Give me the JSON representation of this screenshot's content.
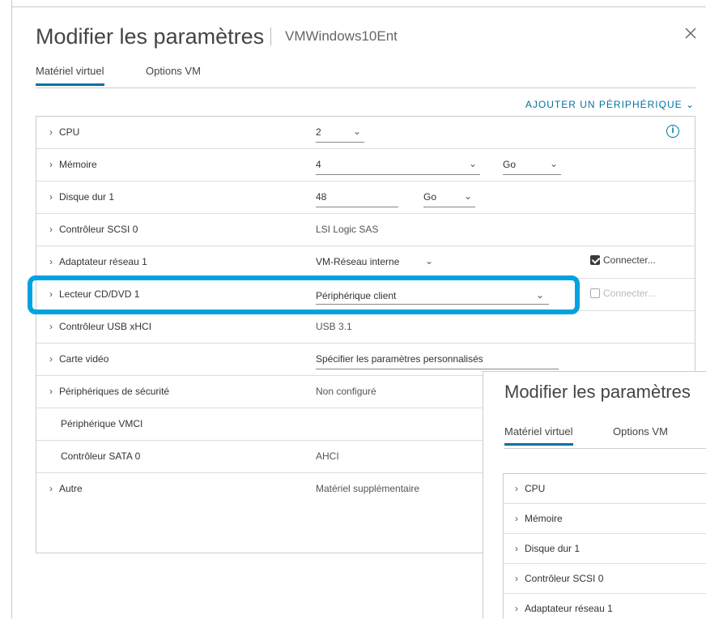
{
  "dialog": {
    "title": "Modifier les paramètres",
    "vm_name": "VMWindows10Ent",
    "close_glyph": "×",
    "tabs": [
      {
        "label": "Matériel virtuel",
        "active": true
      },
      {
        "label": "Options VM",
        "active": false
      }
    ],
    "add_device_label": "AJOUTER UN PÉRIPHÉRIQUE ⌄"
  },
  "rows": {
    "cpu": {
      "label": "CPU",
      "value": "2",
      "info_icon": "info-icon"
    },
    "memory": {
      "label": "Mémoire",
      "value": "4",
      "unit": "Go"
    },
    "disk": {
      "label": "Disque dur 1",
      "value": "48",
      "unit": "Go"
    },
    "scsi": {
      "label": "Contrôleur SCSI 0",
      "value": "LSI Logic SAS"
    },
    "network": {
      "label": "Adaptateur réseau 1",
      "value": "VM-Réseau interne",
      "connect_label": "Connecter...",
      "connected": true
    },
    "cdrom": {
      "label": "Lecteur CD/DVD 1",
      "value": "Périphérique client",
      "connect_label": "Connecter...",
      "connected": false
    },
    "usb": {
      "label": "Contrôleur USB xHCI",
      "value": "USB 3.1"
    },
    "video": {
      "label": "Carte vidéo",
      "value": "Spécifier les paramètres personnalisés"
    },
    "security": {
      "label": "Périphériques de sécurité",
      "value": "Non configuré"
    },
    "vmci": {
      "label": "Périphérique VMCI"
    },
    "sata": {
      "label": "Contrôleur SATA 0",
      "value": "AHCI"
    },
    "other": {
      "label": "Autre",
      "value": "Matériel supplémentaire"
    }
  },
  "chevron": "›",
  "arrow": "⌄",
  "overlay": {
    "title": "Modifier les paramètres",
    "tabs": [
      {
        "label": "Matériel virtuel",
        "active": true
      },
      {
        "label": "Options VM",
        "active": false
      }
    ],
    "rows": [
      "CPU",
      "Mémoire",
      "Disque dur 1",
      "Contrôleur SCSI 0",
      "Adaptateur réseau 1"
    ]
  },
  "colors": {
    "accent": "#0072a3",
    "highlight": "#00a3e0"
  }
}
